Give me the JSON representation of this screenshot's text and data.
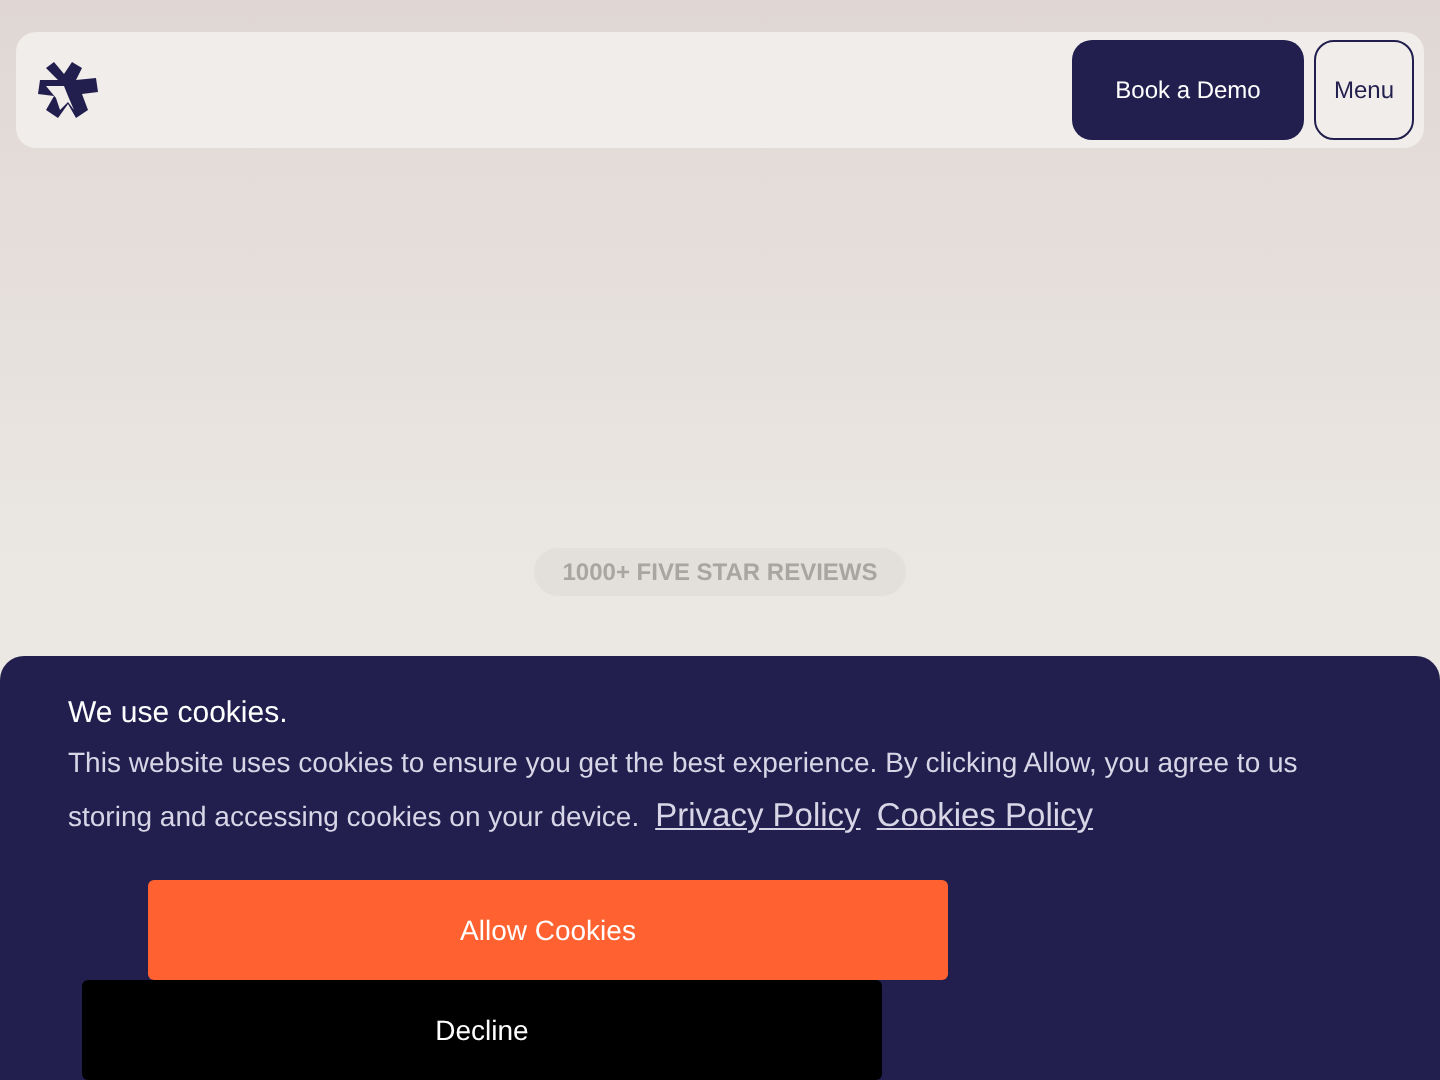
{
  "header": {
    "buttons": [
      {
        "kind": "primary",
        "label": "Book a Demo"
      },
      {
        "kind": "outline",
        "label": "Menu"
      }
    ]
  },
  "hero": {
    "badge": "1000+ FIVE STAR REVIEWS"
  },
  "cookie_banner": {
    "title": "We use cookies.",
    "message": "This website uses cookies to ensure you get the best experience. By clicking Allow, you agree to us storing and accessing cookies on your device.",
    "links": [
      "Privacy Policy",
      "Cookies Policy"
    ],
    "buttons": [
      {
        "kind": "allow",
        "label": "Allow Cookies"
      },
      {
        "kind": "decline",
        "label": "Decline"
      }
    ]
  }
}
